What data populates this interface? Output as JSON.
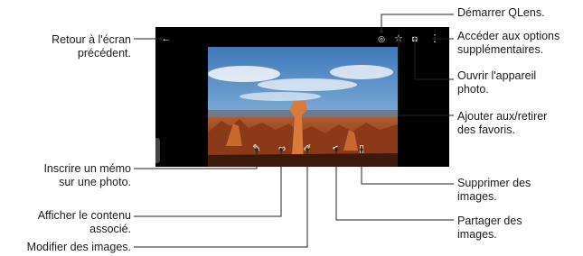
{
  "callouts": {
    "back": [
      "Retour à l'écran",
      "précédent."
    ],
    "qlens": "Démarrer QLens.",
    "more_options": [
      "Accéder aux options",
      "supplémentaires."
    ],
    "camera": [
      "Ouvrir l'appareil",
      "photo."
    ],
    "favorite": [
      "Ajouter aux/retirer",
      "des favoris."
    ],
    "memo": [
      "Inscrire un mémo",
      "sur une photo."
    ],
    "related": [
      "Afficher le contenu",
      "associé."
    ],
    "edit": "Modifier des images.",
    "delete": [
      "Supprimer des",
      "images."
    ],
    "share": [
      "Partager des",
      "images."
    ]
  },
  "icons": {
    "back": "back-arrow-icon",
    "qlens": "qlens-icon",
    "favorite": "star-icon",
    "camera": "camera-icon",
    "more": "more-options-icon",
    "memo": "memo-icon",
    "related": "related-content-icon",
    "edit": "pencil-icon",
    "share": "share-icon",
    "delete": "trash-icon"
  },
  "colors": {
    "screen": "#000000",
    "leader_line": "#222222"
  }
}
